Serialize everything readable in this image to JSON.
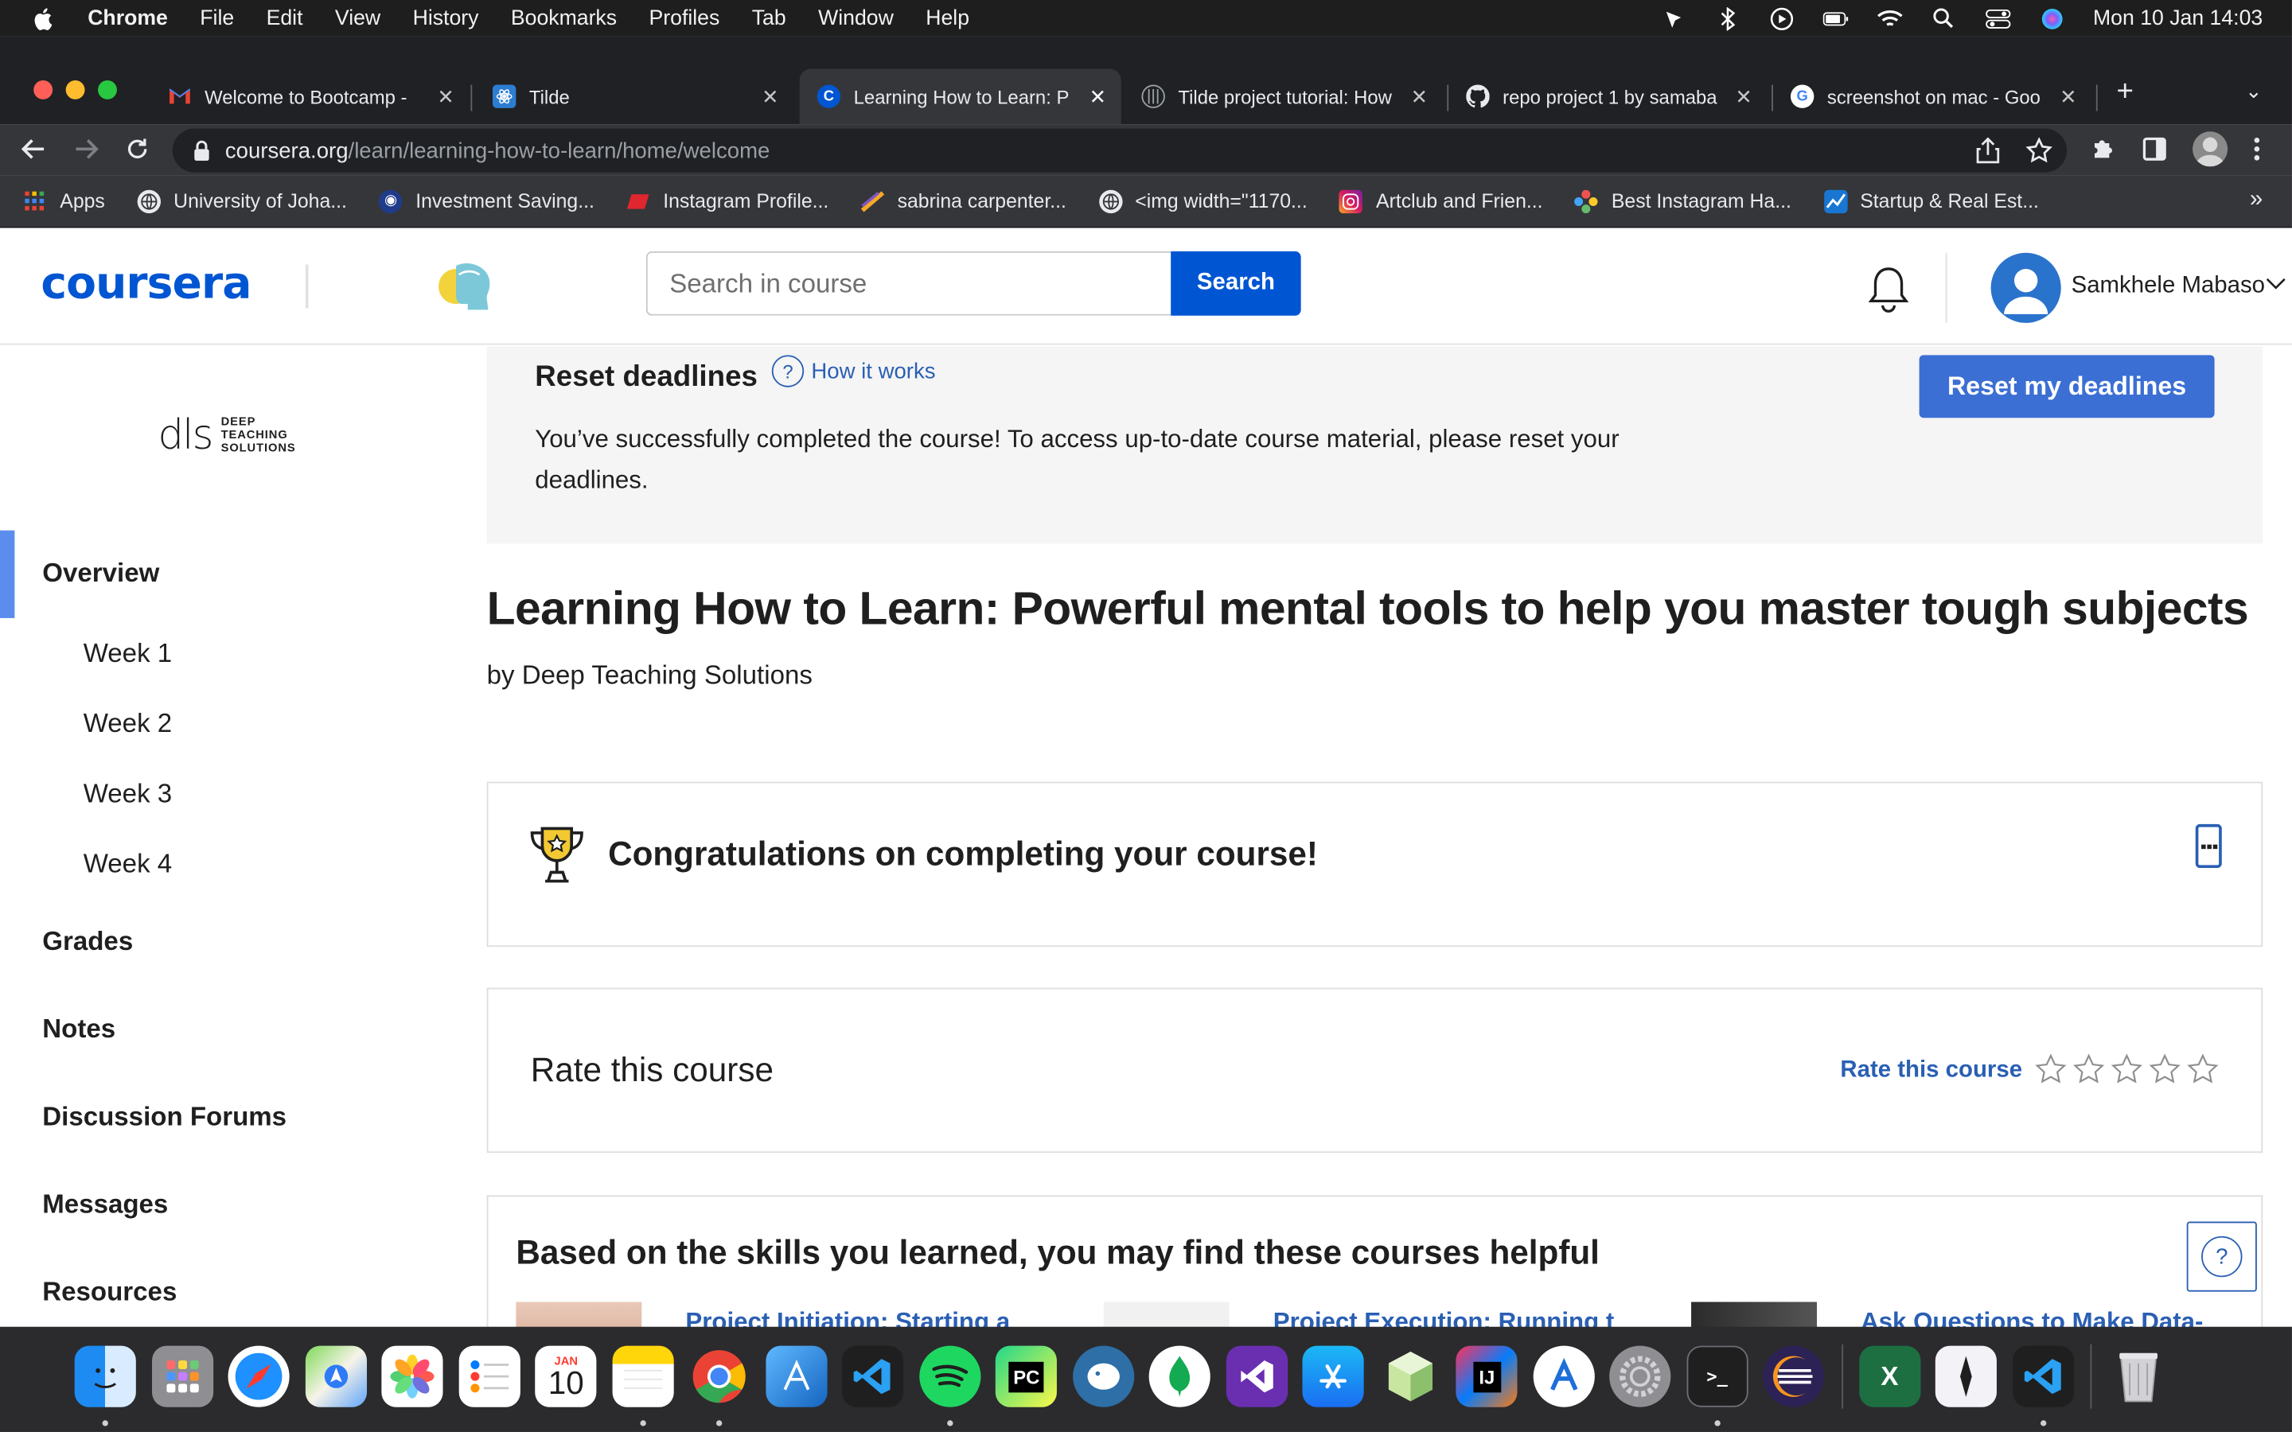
{
  "os": {
    "app_name": "Chrome",
    "menu": [
      "File",
      "Edit",
      "View",
      "History",
      "Bookmarks",
      "Profiles",
      "Tab",
      "Window",
      "Help"
    ],
    "clock": "Mon 10 Jan  14:03"
  },
  "browser": {
    "tabs": [
      {
        "title": "Welcome to Bootcamp - ",
        "icon": "gmail-icon",
        "active": false
      },
      {
        "title": "Tilde",
        "icon": "tilde-icon",
        "active": false
      },
      {
        "title": "Learning How to Learn: P",
        "icon": "coursera-icon",
        "active": true
      },
      {
        "title": "Tilde project tutorial: How",
        "icon": "web-icon",
        "active": false
      },
      {
        "title": "repo project 1 by samaba",
        "icon": "github-icon",
        "active": false
      },
      {
        "title": "screenshot on mac - Goo",
        "icon": "google-icon",
        "active": false
      }
    ],
    "url_host": "coursera.org",
    "url_path": "/learn/learning-how-to-learn/home/welcome",
    "bookmarks": [
      "Apps",
      "University of Joha...",
      "Investment Saving...",
      "Instagram Profile...",
      "sabrina carpenter...",
      "<img width=\"1170...",
      "Artclub and Frien...",
      "Best Instagram Ha...",
      "Startup & Real Est..."
    ]
  },
  "header": {
    "logo": "coursera",
    "search_placeholder": "Search in course",
    "search_button": "Search",
    "user_name": "Samkhele Mabaso"
  },
  "sidebar": {
    "org_lines": [
      "DEEP",
      "TEACHING",
      "SOLUTIONS"
    ],
    "org_mark": "dls",
    "items": {
      "overview": "Overview",
      "week1": "Week 1",
      "week2": "Week 2",
      "week3": "Week 3",
      "week4": "Week 4",
      "grades": "Grades",
      "notes": "Notes",
      "forums": "Discussion Forums",
      "messages": "Messages",
      "resources": "Resources"
    }
  },
  "main": {
    "reset": {
      "title": "Reset deadlines",
      "how_it_works": "How it works",
      "description": "You’ve successfully completed the course! To access up-to-date course material, please reset your deadlines.",
      "button": "Reset my deadlines"
    },
    "course_title": "Learning How to Learn: Powerful mental tools to help you master tough subjects",
    "byline": "by Deep Teaching Solutions",
    "congrats": "Congratulations on completing your course!",
    "rate": {
      "title": "Rate this course",
      "link": "Rate this course",
      "stars_filled": 0,
      "stars_total": 5
    },
    "helpful": {
      "title": "Based on the skills you learned, you may find these courses helpful",
      "courses": [
        "Project Initiation: Starting a",
        "Project Execution: Running t",
        "Ask Questions to Make Data-"
      ]
    }
  },
  "dock": {
    "calendar_month": "JAN",
    "calendar_day": "10"
  }
}
